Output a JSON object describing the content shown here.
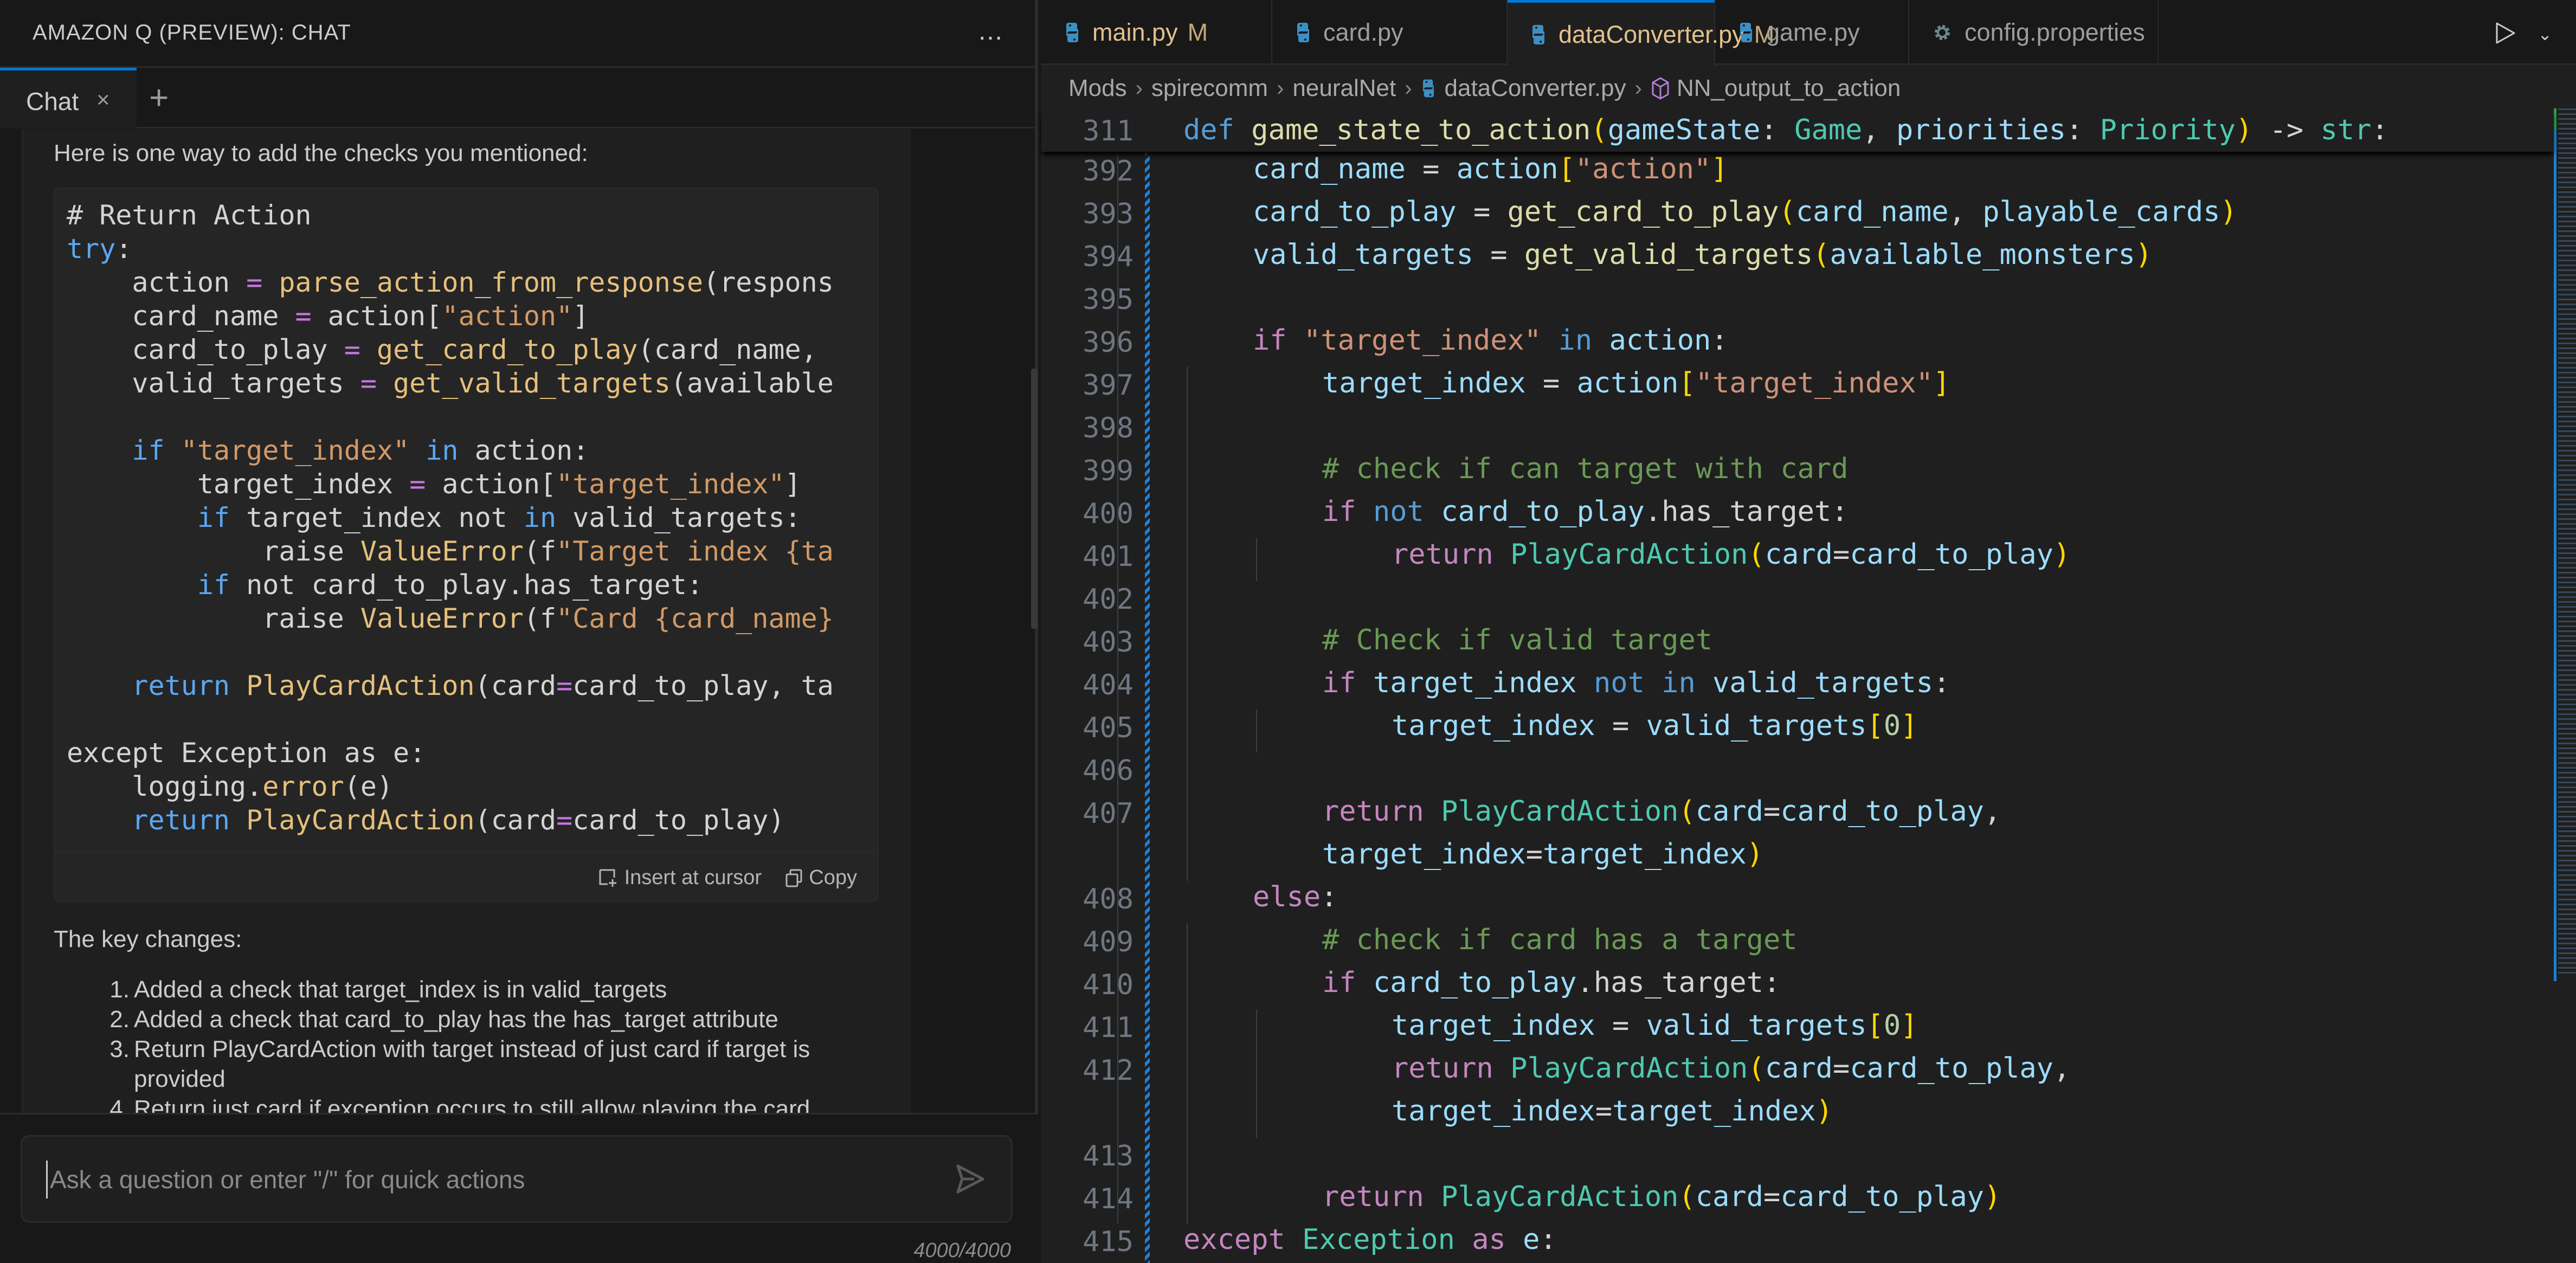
{
  "chat_panel": {
    "title": "AMAZON Q (PREVIEW): CHAT",
    "more_icon": "…",
    "tab_label": "Chat",
    "tab_close": "×",
    "add_tab": "+",
    "intro": "Here is one way to add the checks you mentioned:",
    "code_lines": [
      [
        {
          "t": "# Return Action",
          "c": "c-plain"
        }
      ],
      [
        {
          "t": "try",
          "c": "c-kw"
        },
        {
          "t": ":",
          "c": "c-plain"
        }
      ],
      [
        {
          "t": "    action ",
          "c": "c-plain"
        },
        {
          "t": "=",
          "c": "c-op"
        },
        {
          "t": " ",
          "c": "c-plain"
        },
        {
          "t": "parse_action_from_response",
          "c": "c-fn"
        },
        {
          "t": "(respons",
          "c": "c-plain"
        }
      ],
      [
        {
          "t": "    card_name ",
          "c": "c-plain"
        },
        {
          "t": "=",
          "c": "c-op"
        },
        {
          "t": " action[",
          "c": "c-plain"
        },
        {
          "t": "\"action\"",
          "c": "c-str"
        },
        {
          "t": "]",
          "c": "c-plain"
        }
      ],
      [
        {
          "t": "    card_to_play ",
          "c": "c-plain"
        },
        {
          "t": "=",
          "c": "c-op"
        },
        {
          "t": " ",
          "c": "c-plain"
        },
        {
          "t": "get_card_to_play",
          "c": "c-fn"
        },
        {
          "t": "(card_name,",
          "c": "c-plain"
        }
      ],
      [
        {
          "t": "    valid_targets ",
          "c": "c-plain"
        },
        {
          "t": "=",
          "c": "c-op"
        },
        {
          "t": " ",
          "c": "c-plain"
        },
        {
          "t": "get_valid_targets",
          "c": "c-fn"
        },
        {
          "t": "(available",
          "c": "c-plain"
        }
      ],
      [
        {
          "t": "",
          "c": "c-plain"
        }
      ],
      [
        {
          "t": "    ",
          "c": "c-plain"
        },
        {
          "t": "if",
          "c": "c-kw"
        },
        {
          "t": " ",
          "c": "c-plain"
        },
        {
          "t": "\"target_index\"",
          "c": "c-str"
        },
        {
          "t": " ",
          "c": "c-plain"
        },
        {
          "t": "in",
          "c": "c-kw"
        },
        {
          "t": " action:",
          "c": "c-plain"
        }
      ],
      [
        {
          "t": "        target_index ",
          "c": "c-plain"
        },
        {
          "t": "=",
          "c": "c-op"
        },
        {
          "t": " action[",
          "c": "c-plain"
        },
        {
          "t": "\"target_index\"",
          "c": "c-str"
        },
        {
          "t": "]",
          "c": "c-plain"
        }
      ],
      [
        {
          "t": "        ",
          "c": "c-plain"
        },
        {
          "t": "if",
          "c": "c-kw"
        },
        {
          "t": " target_index not ",
          "c": "c-plain"
        },
        {
          "t": "in",
          "c": "c-kw"
        },
        {
          "t": " valid_targets:",
          "c": "c-plain"
        }
      ],
      [
        {
          "t": "            raise ",
          "c": "c-plain"
        },
        {
          "t": "ValueError",
          "c": "c-fn"
        },
        {
          "t": "(f",
          "c": "c-plain"
        },
        {
          "t": "\"Target index {ta",
          "c": "c-str"
        }
      ],
      [
        {
          "t": "        ",
          "c": "c-plain"
        },
        {
          "t": "if",
          "c": "c-kw"
        },
        {
          "t": " not card_to_play.has_target:",
          "c": "c-plain"
        }
      ],
      [
        {
          "t": "            raise ",
          "c": "c-plain"
        },
        {
          "t": "ValueError",
          "c": "c-fn"
        },
        {
          "t": "(f",
          "c": "c-plain"
        },
        {
          "t": "\"Card {card_name}",
          "c": "c-str"
        }
      ],
      [
        {
          "t": "",
          "c": "c-plain"
        }
      ],
      [
        {
          "t": "    ",
          "c": "c-plain"
        },
        {
          "t": "return",
          "c": "c-kw"
        },
        {
          "t": " ",
          "c": "c-plain"
        },
        {
          "t": "PlayCardAction",
          "c": "c-fn"
        },
        {
          "t": "(card",
          "c": "c-plain"
        },
        {
          "t": "=",
          "c": "c-op"
        },
        {
          "t": "card_to_play, ta",
          "c": "c-plain"
        }
      ],
      [
        {
          "t": "",
          "c": "c-plain"
        }
      ],
      [
        {
          "t": "except Exception as e:",
          "c": "c-plain"
        }
      ],
      [
        {
          "t": "    logging.",
          "c": "c-plain"
        },
        {
          "t": "error",
          "c": "c-fn"
        },
        {
          "t": "(e)",
          "c": "c-plain"
        }
      ],
      [
        {
          "t": "    ",
          "c": "c-plain"
        },
        {
          "t": "return",
          "c": "c-kw"
        },
        {
          "t": " ",
          "c": "c-plain"
        },
        {
          "t": "PlayCardAction",
          "c": "c-fn"
        },
        {
          "t": "(card",
          "c": "c-plain"
        },
        {
          "t": "=",
          "c": "c-op"
        },
        {
          "t": "card_to_play)",
          "c": "c-plain"
        }
      ]
    ],
    "insert_label": "Insert at cursor",
    "copy_label": "Copy",
    "key_changes_heading": "The key changes:",
    "key_changes": [
      {
        "num": "1.",
        "text": "Added a check that target_index is in valid_targets"
      },
      {
        "num": "2.",
        "text": "Added a check that card_to_play has the has_target attribute"
      },
      {
        "num": "3.",
        "text": "Return PlayCardAction with target instead of just card if target is provided"
      },
      {
        "num": "4.",
        "text": "Return just card if exception occurs to still allow playing the card"
      }
    ],
    "input_placeholder": "Ask a question or enter \"/\" for quick actions",
    "input_value": "",
    "char_count": "4000/4000"
  },
  "editor": {
    "tabs": [
      {
        "name": "main.py",
        "badge": "M",
        "icon": "python-icon",
        "modified": true,
        "active": false,
        "dirty": false
      },
      {
        "name": "card.py",
        "badge": "",
        "icon": "python-icon",
        "modified": false,
        "active": false,
        "dirty": false
      },
      {
        "name": "dataConverter.py",
        "badge": "M",
        "icon": "python-icon",
        "modified": true,
        "active": true,
        "dirty": true
      },
      {
        "name": "game.py",
        "badge": "",
        "icon": "python-icon",
        "modified": false,
        "active": false,
        "dirty": false
      },
      {
        "name": "config.properties",
        "badge": "",
        "icon": "gear-icon",
        "modified": false,
        "active": false,
        "dirty": false
      }
    ],
    "breadcrumb": [
      "Mods",
      "spirecomm",
      "neuralNet",
      "dataConverter.py",
      "NN_output_to_action"
    ],
    "sticky_line": {
      "num": "311",
      "tokens": [
        {
          "t": "def",
          "c": "kw2"
        },
        {
          "t": " ",
          "c": "plain"
        },
        {
          "t": "game_state_to_action",
          "c": "fn"
        },
        {
          "t": "(",
          "c": "br1"
        },
        {
          "t": "gameState",
          "c": "var"
        },
        {
          "t": ": ",
          "c": "plain"
        },
        {
          "t": "Game",
          "c": "cls"
        },
        {
          "t": ", ",
          "c": "plain"
        },
        {
          "t": "priorities",
          "c": "var"
        },
        {
          "t": ": ",
          "c": "plain"
        },
        {
          "t": "Priority",
          "c": "cls"
        },
        {
          "t": ")",
          "c": "br1"
        },
        {
          "t": " -> ",
          "c": "plain"
        },
        {
          "t": "str",
          "c": "cls"
        },
        {
          "t": ":",
          "c": "plain"
        }
      ]
    },
    "lines": [
      {
        "num": "392",
        "indent": 2,
        "tokens": [
          {
            "t": "card_name",
            "c": "var"
          },
          {
            "t": " = ",
            "c": "op"
          },
          {
            "t": "action",
            "c": "var"
          },
          {
            "t": "[",
            "c": "br1"
          },
          {
            "t": "\"action\"",
            "c": "str"
          },
          {
            "t": "]",
            "c": "br1"
          }
        ]
      },
      {
        "num": "393",
        "indent": 2,
        "tokens": [
          {
            "t": "card_to_play",
            "c": "var"
          },
          {
            "t": " = ",
            "c": "op"
          },
          {
            "t": "get_card_to_play",
            "c": "fn"
          },
          {
            "t": "(",
            "c": "br1"
          },
          {
            "t": "card_name",
            "c": "var"
          },
          {
            "t": ", ",
            "c": "op"
          },
          {
            "t": "playable_cards",
            "c": "var"
          },
          {
            "t": ")",
            "c": "br1"
          }
        ]
      },
      {
        "num": "394",
        "indent": 2,
        "tokens": [
          {
            "t": "valid_targets",
            "c": "var"
          },
          {
            "t": " = ",
            "c": "op"
          },
          {
            "t": "get_valid_targets",
            "c": "fn"
          },
          {
            "t": "(",
            "c": "br1"
          },
          {
            "t": "available_monsters",
            "c": "var"
          },
          {
            "t": ")",
            "c": "br1"
          }
        ]
      },
      {
        "num": "395",
        "indent": 2,
        "tokens": []
      },
      {
        "num": "396",
        "indent": 2,
        "tokens": [
          {
            "t": "if",
            "c": "kw"
          },
          {
            "t": " ",
            "c": "op"
          },
          {
            "t": "\"target_index\"",
            "c": "str"
          },
          {
            "t": " ",
            "c": "op"
          },
          {
            "t": "in",
            "c": "kw2"
          },
          {
            "t": " ",
            "c": "op"
          },
          {
            "t": "action",
            "c": "var"
          },
          {
            "t": ":",
            "c": "op"
          }
        ]
      },
      {
        "num": "397",
        "indent": 3,
        "tokens": [
          {
            "t": "target_index",
            "c": "var"
          },
          {
            "t": " = ",
            "c": "op"
          },
          {
            "t": "action",
            "c": "var"
          },
          {
            "t": "[",
            "c": "br1"
          },
          {
            "t": "\"target_index\"",
            "c": "str"
          },
          {
            "t": "]",
            "c": "br1"
          }
        ]
      },
      {
        "num": "398",
        "indent": 3,
        "tokens": []
      },
      {
        "num": "399",
        "indent": 3,
        "tokens": [
          {
            "t": "# check if can target with card",
            "c": "cm"
          }
        ]
      },
      {
        "num": "400",
        "indent": 3,
        "tokens": [
          {
            "t": "if",
            "c": "kw"
          },
          {
            "t": " ",
            "c": "op"
          },
          {
            "t": "not",
            "c": "kw2"
          },
          {
            "t": " ",
            "c": "op"
          },
          {
            "t": "card_to_play",
            "c": "var"
          },
          {
            "t": ".has_target:",
            "c": "attr"
          }
        ]
      },
      {
        "num": "401",
        "indent": 4,
        "tokens": [
          {
            "t": "return",
            "c": "kw"
          },
          {
            "t": " ",
            "c": "op"
          },
          {
            "t": "PlayCardAction",
            "c": "cls"
          },
          {
            "t": "(",
            "c": "br1"
          },
          {
            "t": "card",
            "c": "var"
          },
          {
            "t": "=",
            "c": "op"
          },
          {
            "t": "card_to_play",
            "c": "var"
          },
          {
            "t": ")",
            "c": "br1"
          }
        ]
      },
      {
        "num": "402",
        "indent": 3,
        "tokens": []
      },
      {
        "num": "403",
        "indent": 3,
        "tokens": [
          {
            "t": "# Check if valid target",
            "c": "cm"
          }
        ]
      },
      {
        "num": "404",
        "indent": 3,
        "tokens": [
          {
            "t": "if",
            "c": "kw"
          },
          {
            "t": " ",
            "c": "op"
          },
          {
            "t": "target_index",
            "c": "var"
          },
          {
            "t": " ",
            "c": "op"
          },
          {
            "t": "not in",
            "c": "kw2"
          },
          {
            "t": " ",
            "c": "op"
          },
          {
            "t": "valid_targets",
            "c": "var"
          },
          {
            "t": ":",
            "c": "op"
          }
        ]
      },
      {
        "num": "405",
        "indent": 4,
        "tokens": [
          {
            "t": "target_index",
            "c": "var"
          },
          {
            "t": " = ",
            "c": "op"
          },
          {
            "t": "valid_targets",
            "c": "var"
          },
          {
            "t": "[",
            "c": "br1"
          },
          {
            "t": "0",
            "c": "num"
          },
          {
            "t": "]",
            "c": "br1"
          }
        ]
      },
      {
        "num": "406",
        "indent": 3,
        "tokens": []
      },
      {
        "num": "407",
        "indent": 3,
        "tokens": [
          {
            "t": "return",
            "c": "kw"
          },
          {
            "t": " ",
            "c": "op"
          },
          {
            "t": "PlayCardAction",
            "c": "cls"
          },
          {
            "t": "(",
            "c": "br1"
          },
          {
            "t": "card",
            "c": "var"
          },
          {
            "t": "=",
            "c": "op"
          },
          {
            "t": "card_to_play",
            "c": "var"
          },
          {
            "t": ",",
            "c": "op"
          }
        ]
      },
      {
        "num": "",
        "indent": 3,
        "tokens": [
          {
            "t": "target_index",
            "c": "var"
          },
          {
            "t": "=",
            "c": "op"
          },
          {
            "t": "target_index",
            "c": "var"
          },
          {
            "t": ")",
            "c": "br1"
          }
        ]
      },
      {
        "num": "408",
        "indent": 2,
        "tokens": [
          {
            "t": "else",
            "c": "kw"
          },
          {
            "t": ":",
            "c": "op"
          }
        ]
      },
      {
        "num": "409",
        "indent": 3,
        "tokens": [
          {
            "t": "# check if card has a target",
            "c": "cm"
          }
        ]
      },
      {
        "num": "410",
        "indent": 3,
        "tokens": [
          {
            "t": "if",
            "c": "kw"
          },
          {
            "t": " ",
            "c": "op"
          },
          {
            "t": "card_to_play",
            "c": "var"
          },
          {
            "t": ".has_target:",
            "c": "attr"
          }
        ]
      },
      {
        "num": "411",
        "indent": 4,
        "tokens": [
          {
            "t": "target_index",
            "c": "var"
          },
          {
            "t": " = ",
            "c": "op"
          },
          {
            "t": "valid_targets",
            "c": "var"
          },
          {
            "t": "[",
            "c": "br1"
          },
          {
            "t": "0",
            "c": "num"
          },
          {
            "t": "]",
            "c": "br1"
          }
        ]
      },
      {
        "num": "412",
        "indent": 4,
        "tokens": [
          {
            "t": "return",
            "c": "kw"
          },
          {
            "t": " ",
            "c": "op"
          },
          {
            "t": "PlayCardAction",
            "c": "cls"
          },
          {
            "t": "(",
            "c": "br1"
          },
          {
            "t": "card",
            "c": "var"
          },
          {
            "t": "=",
            "c": "op"
          },
          {
            "t": "card_to_play",
            "c": "var"
          },
          {
            "t": ",",
            "c": "op"
          }
        ]
      },
      {
        "num": "",
        "indent": 4,
        "tokens": [
          {
            "t": "target_index",
            "c": "var"
          },
          {
            "t": "=",
            "c": "op"
          },
          {
            "t": "target_index",
            "c": "var"
          },
          {
            "t": ")",
            "c": "br1"
          }
        ]
      },
      {
        "num": "413",
        "indent": 3,
        "tokens": []
      },
      {
        "num": "414",
        "indent": 3,
        "tokens": [
          {
            "t": "return",
            "c": "kw"
          },
          {
            "t": " ",
            "c": "op"
          },
          {
            "t": "PlayCardAction",
            "c": "cls"
          },
          {
            "t": "(",
            "c": "br1"
          },
          {
            "t": "card",
            "c": "var"
          },
          {
            "t": "=",
            "c": "op"
          },
          {
            "t": "card_to_play",
            "c": "var"
          },
          {
            "t": ")",
            "c": "br1"
          }
        ]
      },
      {
        "num": "415",
        "indent": 1,
        "tokens": [
          {
            "t": "except",
            "c": "kw"
          },
          {
            "t": " ",
            "c": "op"
          },
          {
            "t": "Exception",
            "c": "cls"
          },
          {
            "t": " ",
            "c": "op"
          },
          {
            "t": "as",
            "c": "kw"
          },
          {
            "t": " ",
            "c": "op"
          },
          {
            "t": "e",
            "c": "var"
          },
          {
            "t": ":",
            "c": "op"
          }
        ]
      }
    ]
  },
  "colors": {
    "accent": "#0078d4",
    "git_modified": "#1b81d8",
    "git_added": "#2ea043",
    "modified_tab_text": "#e2c08d"
  }
}
